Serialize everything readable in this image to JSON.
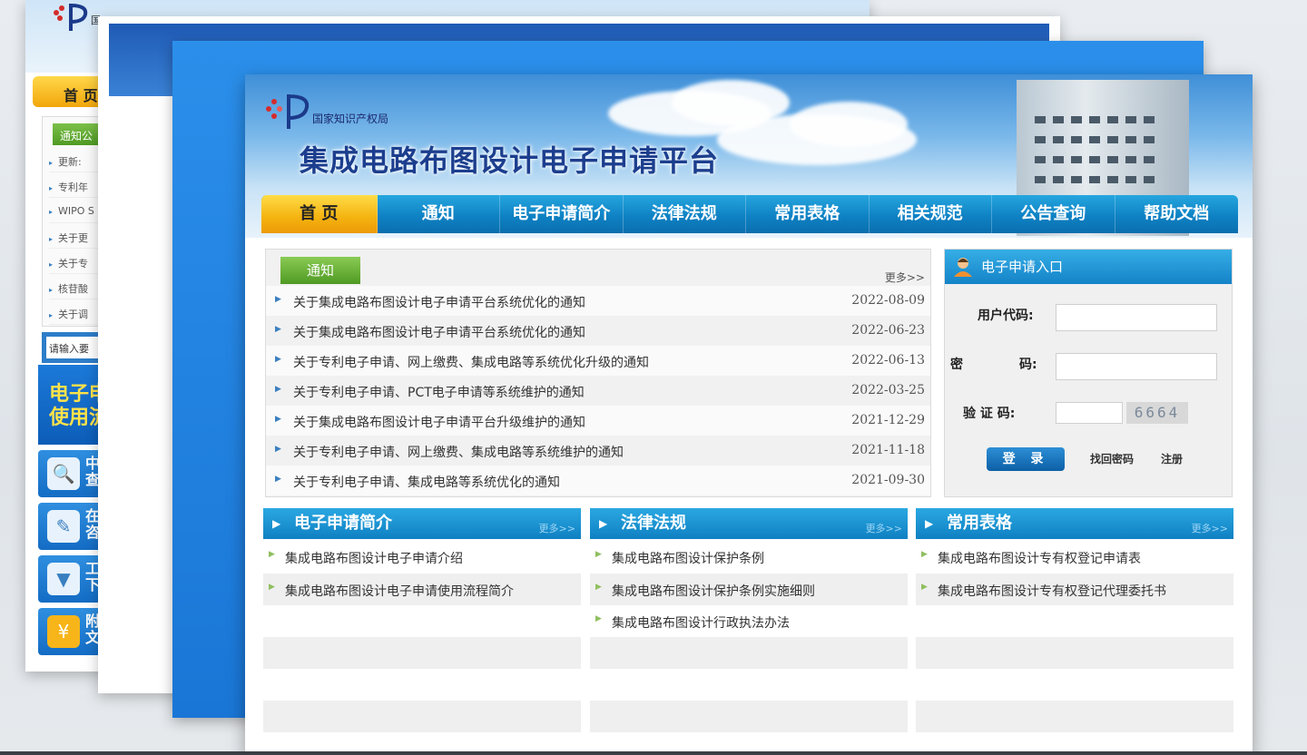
{
  "back_card1": {
    "logo_text": "国",
    "nav_home": "首 页",
    "notice_tab": "通知公",
    "notice_items": [
      "更新:",
      "专利年",
      "WIPO S",
      "关于更",
      "关于专",
      "核苷酸",
      "关于调"
    ],
    "search_placeholder": "请输入要",
    "banner_text": "电子申\n使用流",
    "side_buttons": [
      {
        "icon": "search-icon",
        "glyph": "🔍",
        "label": "中\n查"
      },
      {
        "icon": "pencil-icon",
        "glyph": "✎",
        "label": "在\n咨"
      },
      {
        "icon": "download-icon",
        "glyph": "▼",
        "label": "工\n下"
      },
      {
        "icon": "yen-icon",
        "glyph": "¥",
        "label": "附\n文"
      }
    ]
  },
  "header": {
    "agency_name": "国家知识产权局",
    "site_title": "集成电路布图设计电子申请平台"
  },
  "nav": {
    "items": [
      "首 页",
      "通知",
      "电子申请简介",
      "法律法规",
      "常用表格",
      "相关规范",
      "公告查询",
      "帮助文档"
    ]
  },
  "notice": {
    "tab_label": "通知",
    "more": "更多>>",
    "items": [
      {
        "title": "关于集成电路布图设计电子申请平台系统优化的通知",
        "date": "2022-08-09"
      },
      {
        "title": "关于集成电路布图设计电子申请平台系统优化的通知",
        "date": "2022-06-23"
      },
      {
        "title": "关于专利电子申请、网上缴费、集成电路等系统优化升级的通知",
        "date": "2022-06-13"
      },
      {
        "title": "关于专利电子申请、PCT电子申请等系统维护的通知",
        "date": "2022-03-25"
      },
      {
        "title": "关于集成电路布图设计电子申请平台升级维护的通知",
        "date": "2021-12-29"
      },
      {
        "title": "关于专利电子申请、网上缴费、集成电路等系统维护的通知",
        "date": "2021-11-18"
      },
      {
        "title": "关于专利电子申请、集成电路等系统优化的通知",
        "date": "2021-09-30"
      }
    ]
  },
  "login": {
    "title": "电子申请入口",
    "user_code_label": "用户代码:",
    "password_label_left": "密",
    "password_label_right": "码:",
    "captcha_label": "验 证 码:",
    "captcha_value": "6664",
    "login_button": "登 录",
    "forgot_link": "找回密码",
    "register_link": "注册"
  },
  "columns": [
    {
      "title": "电子申请简介",
      "more": "更多>>",
      "items": [
        "集成电路布图设计电子申请介绍",
        "集成电路布图设计电子申请使用流程简介"
      ]
    },
    {
      "title": "法律法规",
      "more": "更多>>",
      "items": [
        "集成电路布图设计保护条例",
        "集成电路布图设计保护条例实施细则",
        "集成电路布图设计行政执法办法"
      ]
    },
    {
      "title": "常用表格",
      "more": "更多>>",
      "items": [
        "集成电路布图设计专有权登记申请表",
        "集成电路布图设计专有权登记代理委托书"
      ]
    }
  ],
  "colors": {
    "nav_blue": "#0f82c4",
    "home_yellow": "#f4b20f",
    "notice_green": "#4f9a23"
  }
}
